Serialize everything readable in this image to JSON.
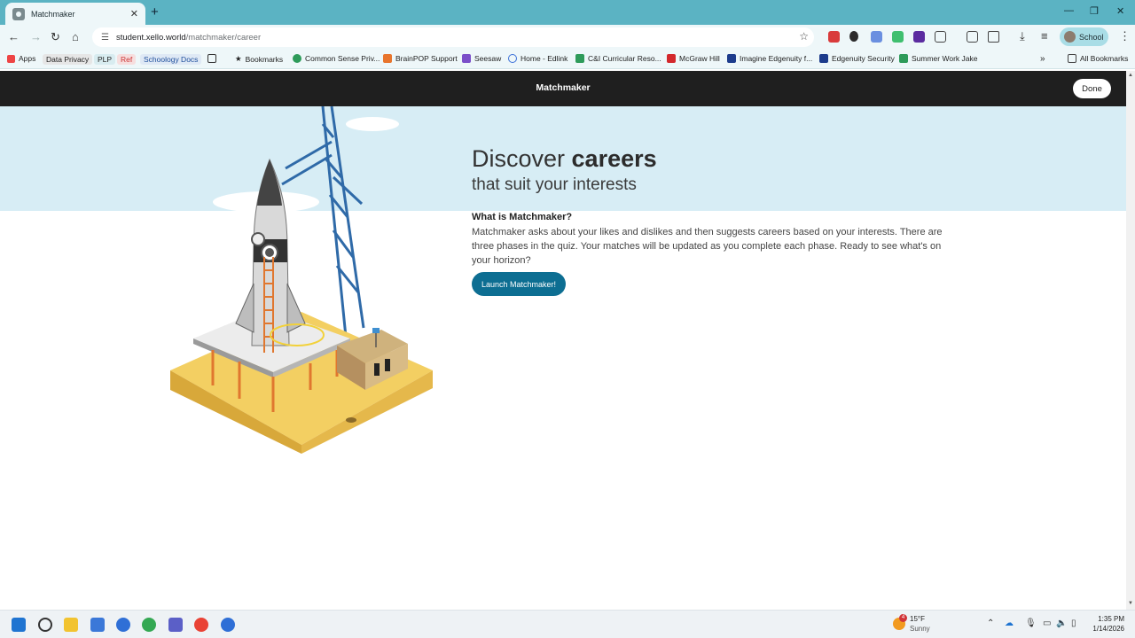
{
  "browser": {
    "tab_title": "Matchmaker",
    "url_host": "student.xello.world",
    "url_path": "/matchmaker/career",
    "profile_label": "School",
    "bookmarks": [
      {
        "label": "Apps"
      },
      {
        "label": "Data Privacy"
      },
      {
        "label": "PLP"
      },
      {
        "label": "Ref"
      },
      {
        "label": "Schoology Docs"
      },
      {
        "label": "Bookmarks"
      },
      {
        "label": "Common Sense Priv..."
      },
      {
        "label": "BrainPOP Support"
      },
      {
        "label": "Seesaw"
      },
      {
        "label": "Home - Edlink"
      },
      {
        "label": "C&I Curricular Reso..."
      },
      {
        "label": "McGraw Hill"
      },
      {
        "label": "Imagine Edgenuity f..."
      },
      {
        "label": "Edgenuity Security"
      },
      {
        "label": "Summer Work Jake"
      }
    ],
    "all_bookmarks_label": "All Bookmarks"
  },
  "app": {
    "header_title": "Matchmaker",
    "done_label": "Done"
  },
  "hero": {
    "headline_light": "Discover ",
    "headline_bold": "careers",
    "subheadline": "that suit your interests",
    "question": "What is Matchmaker?",
    "description": "Matchmaker asks about your likes and dislikes and then suggests careers based on your interests. There are three phases in the quiz. Your matches will be updated as you complete each phase. Ready to see what's on your horizon?",
    "launch_label": "Launch Matchmaker!"
  },
  "taskbar": {
    "weather_temp": "15°F",
    "weather_desc": "Sunny",
    "weather_badge": "4",
    "time": "1:35 PM",
    "date": "1/14/2026"
  },
  "colors": {
    "tab_strip": "#5bb3c3",
    "header": "#1f1f1f",
    "sky": "#d7edf5",
    "launch_button": "#0d6e92"
  }
}
